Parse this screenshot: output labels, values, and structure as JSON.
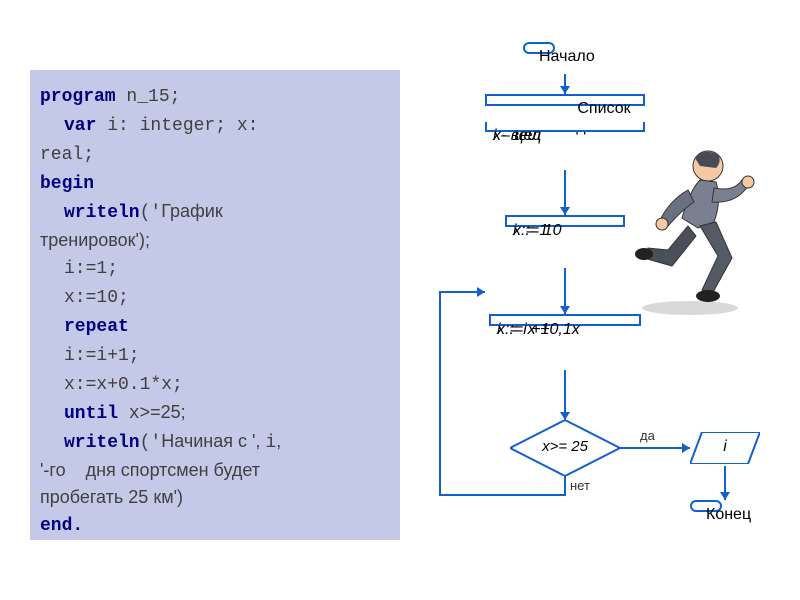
{
  "code": {
    "l1a": "program",
    "l1b": " n_15;",
    "l2a": "var",
    "l2b": " i: integer; x:",
    "l3": "real;",
    "l4": "begin",
    "l5a": "writeln",
    "l5b": "('",
    "l5c": "График",
    "l6": "тренировок');",
    "l7": "i:=1;",
    "l8": "x:=10;",
    "l9": "repeat",
    "l10": "i:=i+1;",
    "l11": "x:=x+0.1*x;",
    "l12a": "until",
    "l12b": " x",
    "l12c": ">=25;",
    "l13a": "writeln",
    "l13b": "('",
    "l13c": "Начиная с ', ",
    "l13d": "i",
    "l13e": ",",
    "l14": "'-го    дня спортсмен будет",
    "l15": "пробегать 25 км')",
    "l16": "end."
  },
  "flow": {
    "start": "Начало",
    "data_header": "Список данных",
    "data_body1": "i – цел",
    "data_body2": "x- вещ",
    "init1": "i := 1",
    "init2": "x := 10",
    "loop1": "i := i +1",
    "loop2": "x := x +0,1x",
    "cond": "x>= 25",
    "cond_yes": "да",
    "cond_no": "нет",
    "out": "i",
    "end": "Конец"
  }
}
